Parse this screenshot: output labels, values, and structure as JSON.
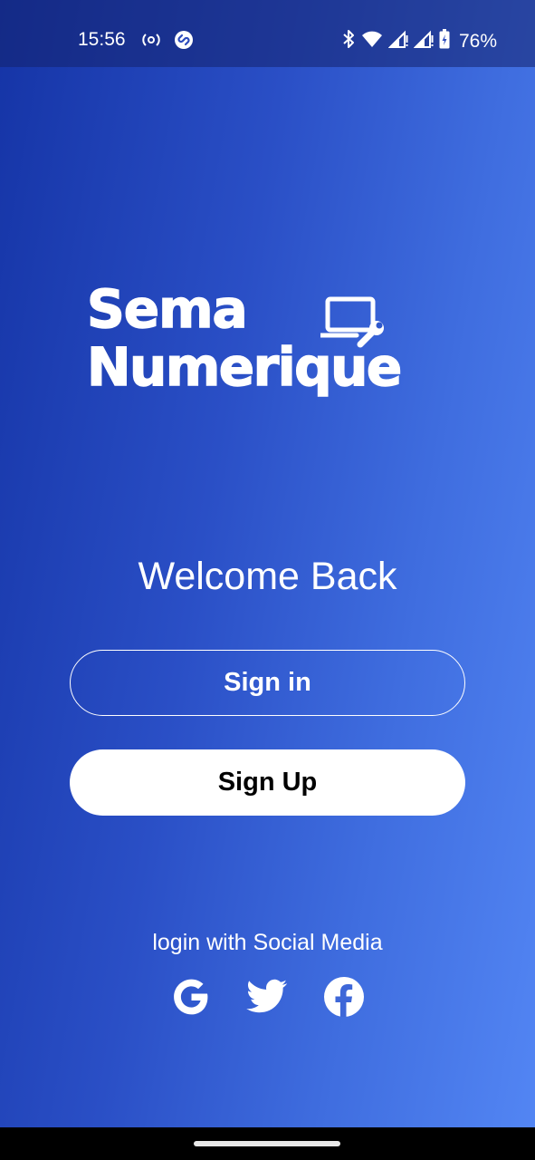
{
  "status_bar": {
    "time": "15:56",
    "battery_percent": "76%",
    "icons": [
      "hotspot-icon",
      "shazam-icon",
      "bluetooth-icon",
      "wifi-icon",
      "signal-icon",
      "signal-icon",
      "battery-icon"
    ]
  },
  "logo": {
    "line1": "Sema",
    "line2": "Numerique"
  },
  "welcome": {
    "title": "Welcome Back"
  },
  "buttons": {
    "sign_in": "Sign in",
    "sign_up": "Sign Up"
  },
  "social": {
    "caption": "login with Social Media",
    "providers": [
      "google-icon",
      "twitter-icon",
      "facebook-icon"
    ]
  },
  "colors": {
    "gradient_start": "#1534a6",
    "gradient_end": "#5386f4",
    "button_fill": "#ffffff",
    "text": "#ffffff"
  }
}
